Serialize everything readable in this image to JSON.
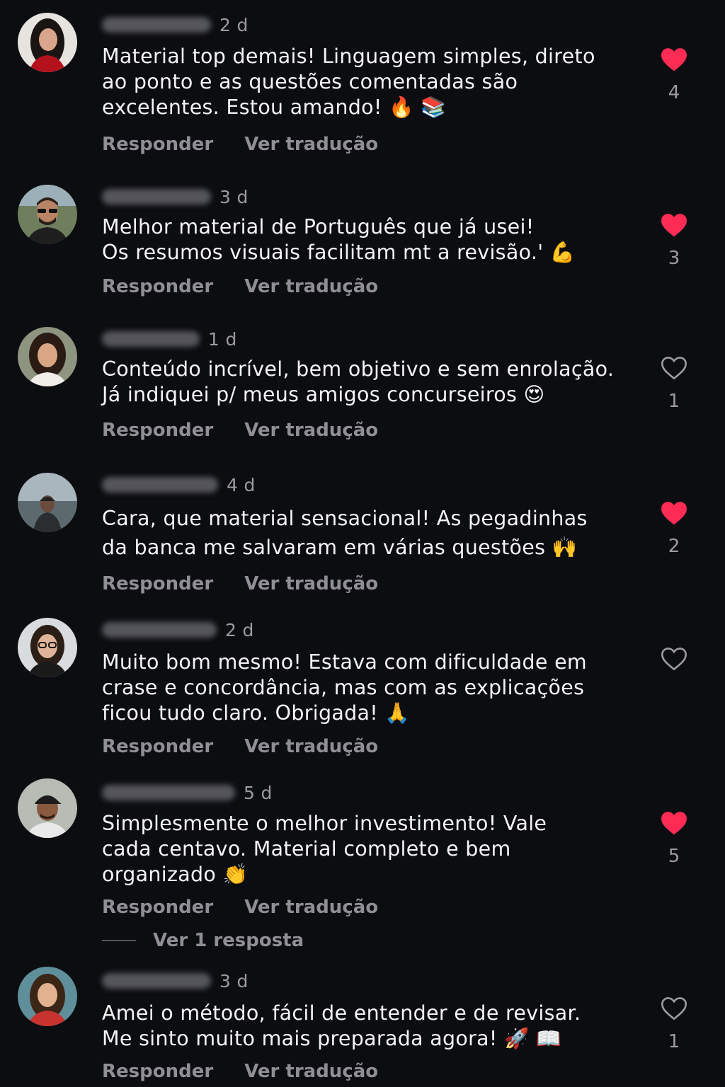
{
  "actions": {
    "reply": "Responder",
    "translate": "Ver tradução"
  },
  "colors": {
    "background": "#0c0d11",
    "liked_heart": "#fe2c55",
    "muted_text": "#9b9ba0"
  },
  "comments": [
    {
      "time": "2 d",
      "lines": [
        "Material top demais! Linguagem simples, direto",
        "ao ponto e as questões comentadas são",
        "excelentes. Estou amando! 🔥 📚"
      ],
      "liked": true,
      "likes": "4",
      "avatar_icon": "woman-avatar"
    },
    {
      "time": "3 d",
      "lines": [
        "Melhor material de Português que já usei!",
        "Os resumos visuais facilitam mt a revisão.' 💪"
      ],
      "liked": true,
      "likes": "3",
      "avatar_icon": "man-sunglasses-avatar"
    },
    {
      "time": "1 d",
      "lines": [
        "Conteúdo incrível, bem objetivo e sem enrolação.",
        "Já indiquei p/ meus amigos concurseiros 😍"
      ],
      "liked": false,
      "likes": "1",
      "avatar_icon": "woman-avatar"
    },
    {
      "time": "4 d",
      "lines": [
        "Cara, que material sensacional! As pegadinhas",
        "da banca me salvaram em várias questões 🙌"
      ],
      "liked": true,
      "likes": "2",
      "avatar_icon": "man-cap-beach-avatar"
    },
    {
      "time": "2 d",
      "lines": [
        "Muito bom mesmo! Estava com dificuldade em",
        "crase e concordância, mas com as explicações",
        "ficou tudo claro. Obrigada! 🙏"
      ],
      "liked": false,
      "likes": "",
      "avatar_icon": "woman-glasses-avatar"
    },
    {
      "time": "5 d",
      "lines": [
        "Simplesmente o melhor investimento! Vale",
        "cada centavo. Material completo e bem",
        "organizado 👏"
      ],
      "liked": true,
      "likes": "5",
      "avatar_icon": "man-cap-avatar",
      "replies_link": "Ver 1 resposta"
    },
    {
      "time": "3 d",
      "lines": [
        "Amei o método, fácil de entender e de revisar.",
        "Me sinto muito mais preparada agora! 🚀 📖"
      ],
      "liked": false,
      "likes": "1",
      "avatar_icon": "woman-avatar"
    }
  ]
}
